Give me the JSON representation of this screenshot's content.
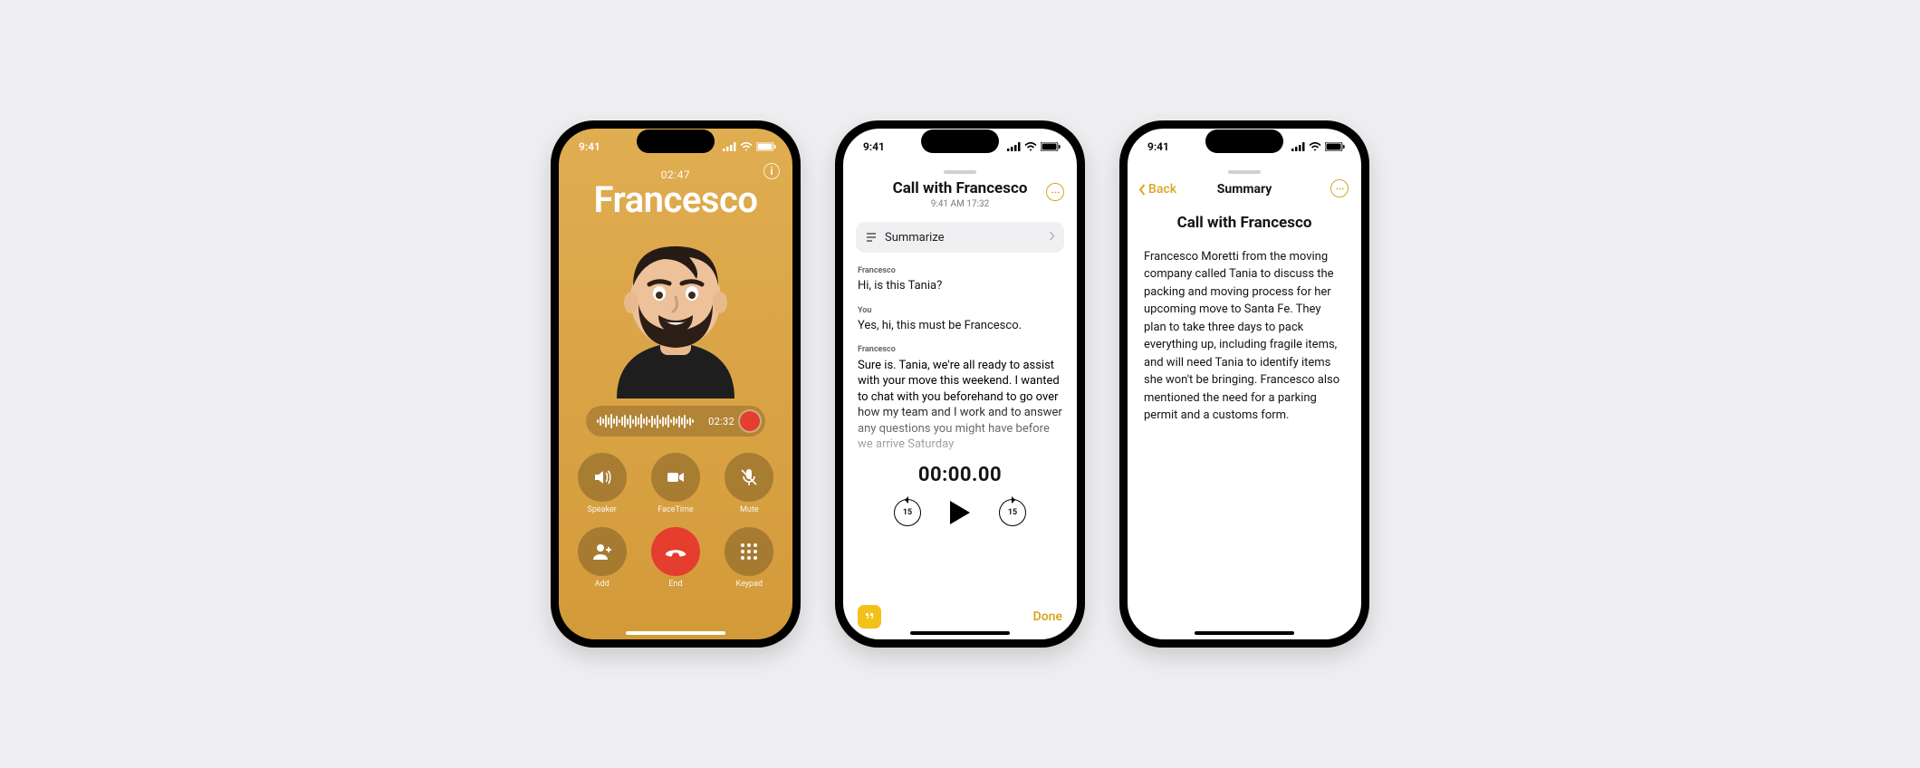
{
  "status_time": "9:41",
  "phone1": {
    "duration": "02:47",
    "name": "Francesco",
    "rec_time": "02:32",
    "buttons": {
      "speaker": "Speaker",
      "facetime": "FaceTime",
      "mute": "Mute",
      "add": "Add",
      "end": "End",
      "keypad": "Keypad"
    },
    "info": "i"
  },
  "phone2": {
    "title": "Call with Francesco",
    "subtitle": "9:41 AM  17:32",
    "summarize": "Summarize",
    "transcript": [
      {
        "who": "Francesco",
        "text": "Hi, is this Tania?"
      },
      {
        "who": "You",
        "text": "Yes, hi, this must be Francesco."
      },
      {
        "who": "Francesco",
        "text": "Sure is. Tania, we're all ready to assist with your move this weekend. I wanted to chat with you beforehand to go over how my team and I work and to answer any questions you might have before we arrive Saturday"
      }
    ],
    "playback_time": "00:00.00",
    "skip_back": "15",
    "skip_fwd": "15",
    "done": "Done"
  },
  "phone3": {
    "back": "Back",
    "header": "Summary",
    "title": "Call with Francesco",
    "body": "Francesco Moretti from the moving company called Tania to discuss the packing and moving process for her upcoming move to Santa Fe. They plan to take three days to pack everything up, including fragile items, and will need Tania to identify items she won't be bringing. Francesco also mentioned the need for a parking permit and a customs form."
  }
}
